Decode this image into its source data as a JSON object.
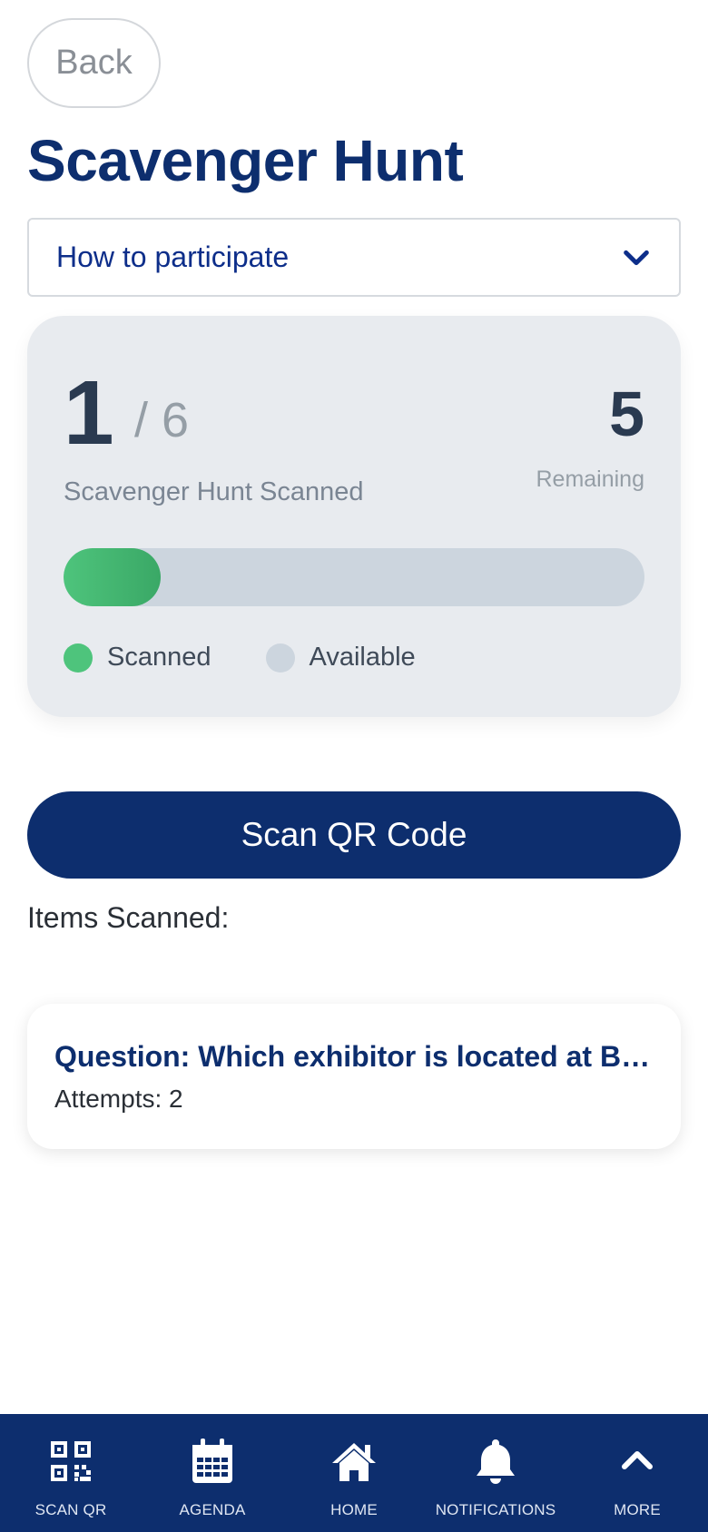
{
  "header": {
    "back_label": "Back",
    "title": "Scavenger Hunt"
  },
  "accordion": {
    "label": "How to participate",
    "icon": "chevron-down-icon"
  },
  "progress": {
    "current": "1",
    "total": "/ 6",
    "remaining_count": "5",
    "remaining_label": "Remaining",
    "scanned_label": "Scavenger Hunt Scanned",
    "fraction_scanned": 0.1667,
    "legend": {
      "scanned": "Scanned",
      "available": "Available"
    },
    "colors": {
      "scanned": "#4ec47c",
      "available": "#ccd5de"
    }
  },
  "scan_button": {
    "label": "Scan QR Code"
  },
  "items": {
    "heading": "Items Scanned:",
    "list": [
      {
        "question": "Question: Which exhibitor is located at B…",
        "attempts": "Attempts: 2"
      }
    ]
  },
  "bottom_nav": {
    "items": [
      {
        "label": "SCAN QR",
        "icon": "qr-code-icon"
      },
      {
        "label": "AGENDA",
        "icon": "calendar-icon"
      },
      {
        "label": "HOME",
        "icon": "home-icon"
      },
      {
        "label": "NOTIFICATIONS",
        "icon": "bell-icon"
      },
      {
        "label": "MORE",
        "icon": "chevron-up-icon"
      }
    ]
  },
  "theme": {
    "primary": "#0d2e6e",
    "accent_text": "#0d2e8a"
  }
}
